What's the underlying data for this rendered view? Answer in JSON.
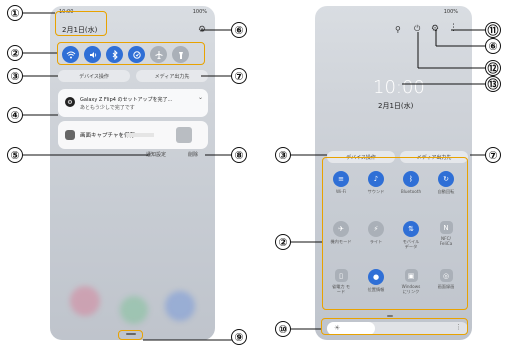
{
  "left_phone": {
    "status_time": "10:00",
    "status_right": "100%",
    "date": "2月1日(水)",
    "pill_device": "デバイス操作",
    "pill_media": "メディア出力先",
    "notification1_title": "Galaxy Z Flip4 のセットアップを完了...",
    "notification1_subtitle": "あともう少しで完了です",
    "notification2_title": "画面キャプチャを保存",
    "footer_notify_settings": "通知設定",
    "footer_clear": "削除"
  },
  "right_phone": {
    "status_right": "100%",
    "clock": "10:00",
    "date": "2月1日(水)",
    "pill_device": "デバイス操作",
    "pill_media": "メディア出力先",
    "tiles": [
      {
        "label": "Wi-Fi",
        "icon": "wifi-icon",
        "on": true
      },
      {
        "label": "サウンド",
        "icon": "sound-icon",
        "on": true
      },
      {
        "label": "Bluetooth",
        "icon": "bluetooth-icon",
        "on": true
      },
      {
        "label": "自動回転",
        "icon": "rotate-icon",
        "on": true
      },
      {
        "label": "機内モード",
        "icon": "airplane-icon",
        "on": false
      },
      {
        "label": "ライト",
        "icon": "flashlight-icon",
        "on": false
      },
      {
        "label": "モバイル データ",
        "icon": "mobile-data-icon",
        "on": true
      },
      {
        "label": "NFC/ FeliCa",
        "icon": "nfc-icon",
        "on": false
      },
      {
        "label": "省電力 モード",
        "icon": "battery-icon",
        "on": false
      },
      {
        "label": "位置情報",
        "icon": "location-icon",
        "on": true
      },
      {
        "label": "Windows にリンク",
        "icon": "link-windows-icon",
        "on": false
      },
      {
        "label": "画面録画",
        "icon": "screen-record-icon",
        "on": false
      }
    ]
  },
  "callouts": {
    "c1": "①",
    "c2": "②",
    "c3": "③",
    "c4": "④",
    "c5": "⑤",
    "c6": "⑥",
    "c7": "⑦",
    "c8": "⑧",
    "c9": "⑨",
    "c10": "⑩",
    "c11": "⑪",
    "c12": "⑫",
    "c13": "⑬"
  },
  "colors": {
    "accent": "#2f6fd6",
    "highlight": "#e8a200",
    "tile_off": "#aab0b8"
  }
}
